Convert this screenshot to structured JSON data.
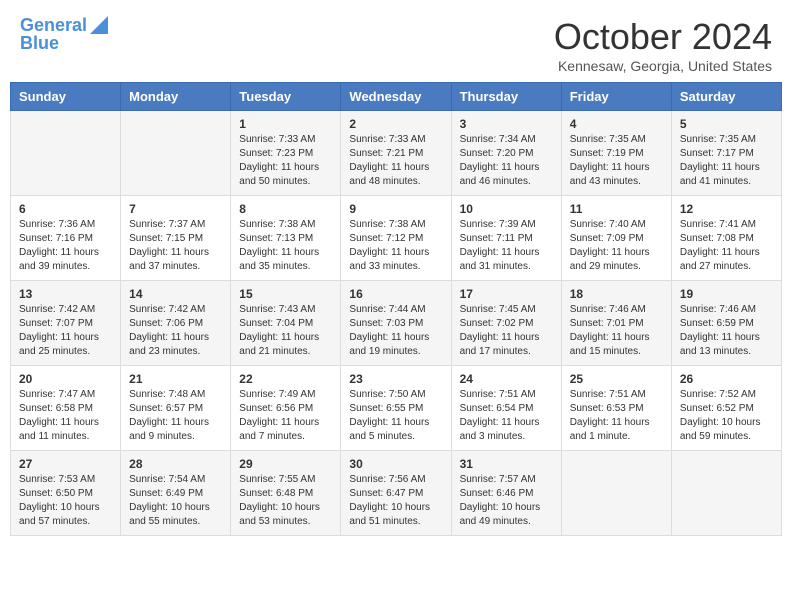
{
  "header": {
    "logo_line1": "General",
    "logo_line2": "Blue",
    "title": "October 2024",
    "subtitle": "Kennesaw, Georgia, United States"
  },
  "days_of_week": [
    "Sunday",
    "Monday",
    "Tuesday",
    "Wednesday",
    "Thursday",
    "Friday",
    "Saturday"
  ],
  "weeks": [
    [
      {
        "day": "",
        "info": ""
      },
      {
        "day": "",
        "info": ""
      },
      {
        "day": "1",
        "info": "Sunrise: 7:33 AM\nSunset: 7:23 PM\nDaylight: 11 hours and 50 minutes."
      },
      {
        "day": "2",
        "info": "Sunrise: 7:33 AM\nSunset: 7:21 PM\nDaylight: 11 hours and 48 minutes."
      },
      {
        "day": "3",
        "info": "Sunrise: 7:34 AM\nSunset: 7:20 PM\nDaylight: 11 hours and 46 minutes."
      },
      {
        "day": "4",
        "info": "Sunrise: 7:35 AM\nSunset: 7:19 PM\nDaylight: 11 hours and 43 minutes."
      },
      {
        "day": "5",
        "info": "Sunrise: 7:35 AM\nSunset: 7:17 PM\nDaylight: 11 hours and 41 minutes."
      }
    ],
    [
      {
        "day": "6",
        "info": "Sunrise: 7:36 AM\nSunset: 7:16 PM\nDaylight: 11 hours and 39 minutes."
      },
      {
        "day": "7",
        "info": "Sunrise: 7:37 AM\nSunset: 7:15 PM\nDaylight: 11 hours and 37 minutes."
      },
      {
        "day": "8",
        "info": "Sunrise: 7:38 AM\nSunset: 7:13 PM\nDaylight: 11 hours and 35 minutes."
      },
      {
        "day": "9",
        "info": "Sunrise: 7:38 AM\nSunset: 7:12 PM\nDaylight: 11 hours and 33 minutes."
      },
      {
        "day": "10",
        "info": "Sunrise: 7:39 AM\nSunset: 7:11 PM\nDaylight: 11 hours and 31 minutes."
      },
      {
        "day": "11",
        "info": "Sunrise: 7:40 AM\nSunset: 7:09 PM\nDaylight: 11 hours and 29 minutes."
      },
      {
        "day": "12",
        "info": "Sunrise: 7:41 AM\nSunset: 7:08 PM\nDaylight: 11 hours and 27 minutes."
      }
    ],
    [
      {
        "day": "13",
        "info": "Sunrise: 7:42 AM\nSunset: 7:07 PM\nDaylight: 11 hours and 25 minutes."
      },
      {
        "day": "14",
        "info": "Sunrise: 7:42 AM\nSunset: 7:06 PM\nDaylight: 11 hours and 23 minutes."
      },
      {
        "day": "15",
        "info": "Sunrise: 7:43 AM\nSunset: 7:04 PM\nDaylight: 11 hours and 21 minutes."
      },
      {
        "day": "16",
        "info": "Sunrise: 7:44 AM\nSunset: 7:03 PM\nDaylight: 11 hours and 19 minutes."
      },
      {
        "day": "17",
        "info": "Sunrise: 7:45 AM\nSunset: 7:02 PM\nDaylight: 11 hours and 17 minutes."
      },
      {
        "day": "18",
        "info": "Sunrise: 7:46 AM\nSunset: 7:01 PM\nDaylight: 11 hours and 15 minutes."
      },
      {
        "day": "19",
        "info": "Sunrise: 7:46 AM\nSunset: 6:59 PM\nDaylight: 11 hours and 13 minutes."
      }
    ],
    [
      {
        "day": "20",
        "info": "Sunrise: 7:47 AM\nSunset: 6:58 PM\nDaylight: 11 hours and 11 minutes."
      },
      {
        "day": "21",
        "info": "Sunrise: 7:48 AM\nSunset: 6:57 PM\nDaylight: 11 hours and 9 minutes."
      },
      {
        "day": "22",
        "info": "Sunrise: 7:49 AM\nSunset: 6:56 PM\nDaylight: 11 hours and 7 minutes."
      },
      {
        "day": "23",
        "info": "Sunrise: 7:50 AM\nSunset: 6:55 PM\nDaylight: 11 hours and 5 minutes."
      },
      {
        "day": "24",
        "info": "Sunrise: 7:51 AM\nSunset: 6:54 PM\nDaylight: 11 hours and 3 minutes."
      },
      {
        "day": "25",
        "info": "Sunrise: 7:51 AM\nSunset: 6:53 PM\nDaylight: 11 hours and 1 minute."
      },
      {
        "day": "26",
        "info": "Sunrise: 7:52 AM\nSunset: 6:52 PM\nDaylight: 10 hours and 59 minutes."
      }
    ],
    [
      {
        "day": "27",
        "info": "Sunrise: 7:53 AM\nSunset: 6:50 PM\nDaylight: 10 hours and 57 minutes."
      },
      {
        "day": "28",
        "info": "Sunrise: 7:54 AM\nSunset: 6:49 PM\nDaylight: 10 hours and 55 minutes."
      },
      {
        "day": "29",
        "info": "Sunrise: 7:55 AM\nSunset: 6:48 PM\nDaylight: 10 hours and 53 minutes."
      },
      {
        "day": "30",
        "info": "Sunrise: 7:56 AM\nSunset: 6:47 PM\nDaylight: 10 hours and 51 minutes."
      },
      {
        "day": "31",
        "info": "Sunrise: 7:57 AM\nSunset: 6:46 PM\nDaylight: 10 hours and 49 minutes."
      },
      {
        "day": "",
        "info": ""
      },
      {
        "day": "",
        "info": ""
      }
    ]
  ]
}
